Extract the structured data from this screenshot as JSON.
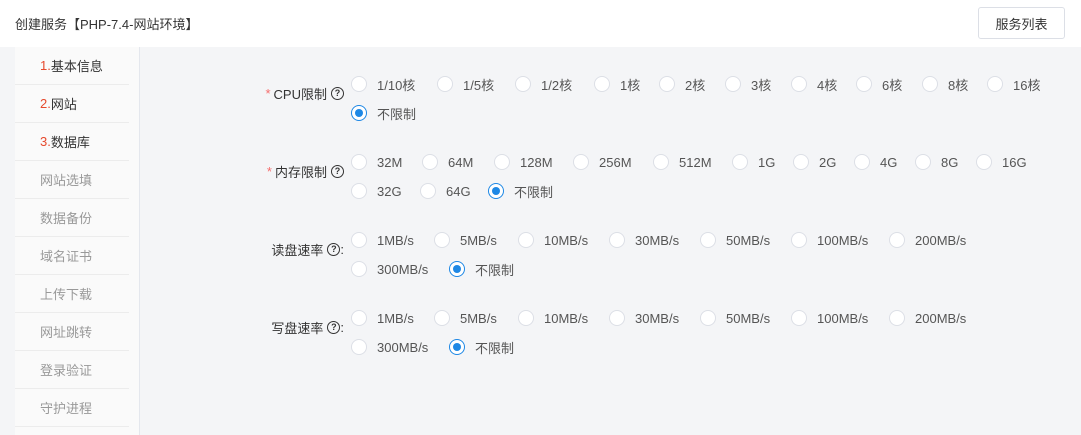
{
  "header": {
    "title": "创建服务【PHP-7.4-网站环境】",
    "list_button": "服务列表"
  },
  "sidebar": {
    "items": [
      {
        "num": "1.",
        "label": "基本信息"
      },
      {
        "num": "2.",
        "label": "网站"
      },
      {
        "num": "3.",
        "label": "数据库"
      },
      {
        "num": "",
        "label": "网站选填"
      },
      {
        "num": "",
        "label": "数据备份"
      },
      {
        "num": "",
        "label": "域名证书"
      },
      {
        "num": "",
        "label": "上传下载"
      },
      {
        "num": "",
        "label": "网址跳转"
      },
      {
        "num": "",
        "label": "登录验证"
      },
      {
        "num": "",
        "label": "守护进程"
      }
    ]
  },
  "form": {
    "cpu": {
      "label": "CPU限制",
      "options": [
        "1/10核",
        "1/5核",
        "1/2核",
        "1核",
        "2核",
        "3核",
        "4核",
        "6核",
        "8核",
        "16核",
        "不限制"
      ],
      "selected": "不限制"
    },
    "memory": {
      "label": "内存限制",
      "options": [
        "32M",
        "64M",
        "128M",
        "256M",
        "512M",
        "1G",
        "2G",
        "4G",
        "8G",
        "16G",
        "32G",
        "64G",
        "不限制"
      ],
      "selected": "不限制"
    },
    "read": {
      "label": "读盘速率",
      "colon": ":",
      "options": [
        "1MB/s",
        "5MB/s",
        "10MB/s",
        "30MB/s",
        "50MB/s",
        "100MB/s",
        "200MB/s",
        "300MB/s",
        "不限制"
      ],
      "selected": "不限制"
    },
    "write": {
      "label": "写盘速率",
      "colon": ":",
      "options": [
        "1MB/s",
        "5MB/s",
        "10MB/s",
        "30MB/s",
        "50MB/s",
        "100MB/s",
        "200MB/s",
        "300MB/s",
        "不限制"
      ],
      "selected": "不限制"
    },
    "required_mark": "*",
    "help_glyph": "?"
  },
  "colors": {
    "accent": "#1e88e5",
    "required": "#f56c6c",
    "step_number": "#e6492d"
  }
}
